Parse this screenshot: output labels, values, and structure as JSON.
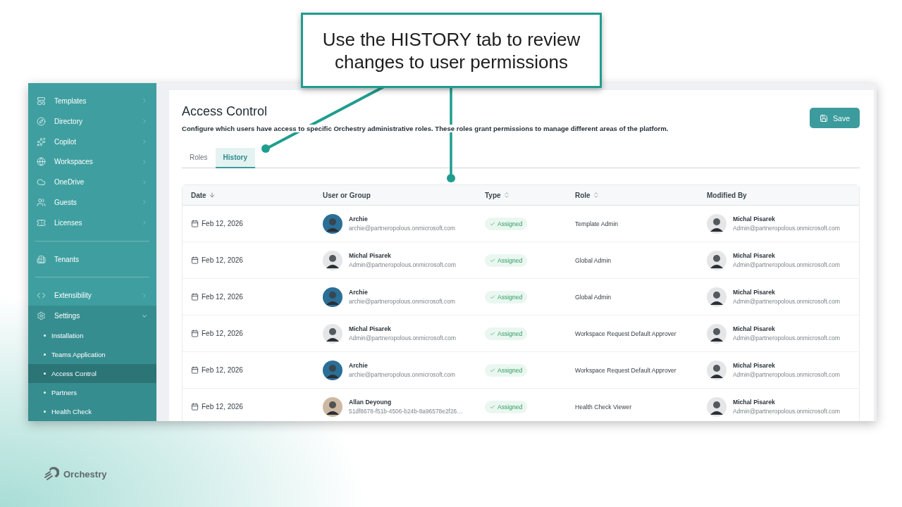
{
  "callout": {
    "text": "Use the HISTORY tab to review changes to user permissions"
  },
  "sidebar": {
    "items": [
      {
        "kind": "item",
        "label": "Templates",
        "expandable": true,
        "expanded": false
      },
      {
        "kind": "item",
        "label": "Directory",
        "expandable": true,
        "expanded": false
      },
      {
        "kind": "item",
        "label": "Copilot",
        "expandable": true,
        "expanded": false
      },
      {
        "kind": "item",
        "label": "Workspaces",
        "expandable": true,
        "expanded": false
      },
      {
        "kind": "item",
        "label": "OneDrive",
        "expandable": true,
        "expanded": false
      },
      {
        "kind": "item",
        "label": "Guests",
        "expandable": true,
        "expanded": false
      },
      {
        "kind": "item",
        "label": "Licenses",
        "expandable": true,
        "expanded": false
      },
      {
        "kind": "divider"
      },
      {
        "kind": "item",
        "label": "Tenants",
        "expandable": false,
        "expanded": false
      },
      {
        "kind": "divider"
      },
      {
        "kind": "item",
        "label": "Extensibility",
        "expandable": true,
        "expanded": false
      },
      {
        "kind": "item",
        "label": "Settings",
        "expandable": true,
        "expanded": true,
        "children": [
          {
            "label": "Installation",
            "selected": false
          },
          {
            "label": "Teams Application",
            "selected": false
          },
          {
            "label": "Access Control",
            "selected": true
          },
          {
            "label": "Partners",
            "selected": false
          },
          {
            "label": "Health Check",
            "selected": false
          }
        ]
      }
    ]
  },
  "page": {
    "title": "Access Control",
    "description": "Configure which users have access to specific Orchestry administrative roles. These roles grant permissions to manage different areas of the platform.",
    "save_button": "Save"
  },
  "tabs": [
    {
      "label": "Roles",
      "selected": false
    },
    {
      "label": "History",
      "selected": true
    }
  ],
  "table": {
    "columns": [
      {
        "label": "Date",
        "sorted": true,
        "sortable": true
      },
      {
        "label": "User or Group",
        "sorted": false,
        "sortable": false
      },
      {
        "label": "Type",
        "sorted": false,
        "sortable": true
      },
      {
        "label": "Role",
        "sorted": false,
        "sortable": true
      },
      {
        "label": "Modified By",
        "sorted": false,
        "sortable": false
      }
    ],
    "rows": [
      {
        "date": "Feb 12, 2026",
        "user": {
          "name": "Archie",
          "email": "archie@partneropolous.onmicrosoft.com",
          "color": "#2b6e96"
        },
        "type": "Assigned",
        "role": "Template Admin",
        "modified_by": {
          "name": "Michal Pisarek",
          "email": "Admin@partneropolous.onmicrosoft.com",
          "color": "#e4e6e8"
        }
      },
      {
        "date": "Feb 12, 2026",
        "user": {
          "name": "Michal Pisarek",
          "email": "Admin@partneropolous.onmicrosoft.com",
          "color": "#e4e6e8"
        },
        "type": "Assigned",
        "role": "Global Admin",
        "modified_by": {
          "name": "Michal Pisarek",
          "email": "Admin@partneropolous.onmicrosoft.com",
          "color": "#e4e6e8"
        }
      },
      {
        "date": "Feb 12, 2026",
        "user": {
          "name": "Archie",
          "email": "archie@partneropolous.onmicrosoft.com",
          "color": "#2b6e96"
        },
        "type": "Assigned",
        "role": "Global Admin",
        "modified_by": {
          "name": "Michal Pisarek",
          "email": "Admin@partneropolous.onmicrosoft.com",
          "color": "#e4e6e8"
        }
      },
      {
        "date": "Feb 12, 2026",
        "user": {
          "name": "Michal Pisarek",
          "email": "Admin@partneropolous.onmicrosoft.com",
          "color": "#e4e6e8"
        },
        "type": "Assigned",
        "role": "Workspace Request Default Approver",
        "modified_by": {
          "name": "Michal Pisarek",
          "email": "Admin@partneropolous.onmicrosoft.com",
          "color": "#e4e6e8"
        }
      },
      {
        "date": "Feb 12, 2026",
        "user": {
          "name": "Archie",
          "email": "archie@partneropolous.onmicrosoft.com",
          "color": "#2b6e96"
        },
        "type": "Assigned",
        "role": "Workspace Request Default Approver",
        "modified_by": {
          "name": "Michal Pisarek",
          "email": "Admin@partneropolous.onmicrosoft.com",
          "color": "#e4e6e8"
        }
      },
      {
        "date": "Feb 12, 2026",
        "user": {
          "name": "Allan Deyoung",
          "email": "51df8678-f51b-4506-b24b-8a96578e2f26…",
          "color": "#cdb9a3"
        },
        "type": "Assigned",
        "role": "Health Check Viewer",
        "modified_by": {
          "name": "Michal Pisarek",
          "email": "Admin@partneropolous.onmicrosoft.com",
          "color": "#e4e6e8"
        }
      }
    ]
  },
  "brand": {
    "name": "Orchestry"
  }
}
